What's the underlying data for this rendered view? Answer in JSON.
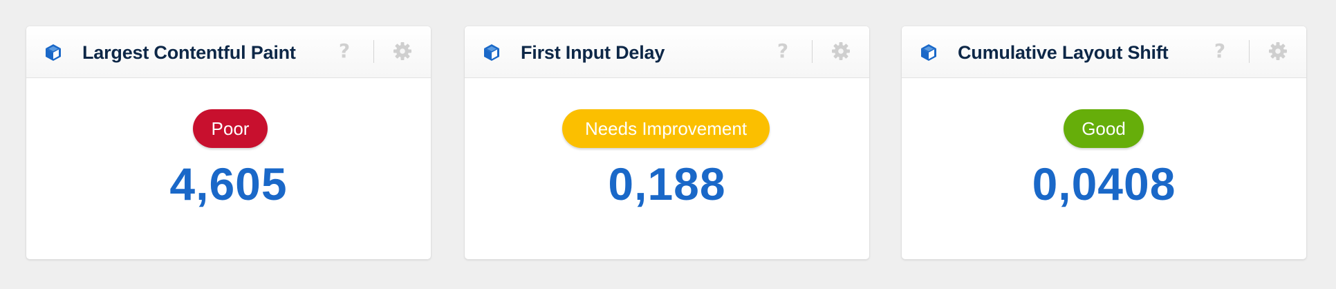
{
  "colors": {
    "poor": "#c8102e",
    "needs_improvement": "#fbbf00",
    "good": "#66ae0a",
    "value": "#1a68c8",
    "title": "#0d2747",
    "icon_blue": "#1a68c8",
    "icon_gray": "#cfcfcf"
  },
  "widgets": [
    {
      "title": "Largest Contentful Paint",
      "icon": "cube-icon",
      "help_label": "?",
      "settings_icon": "gear-icon",
      "status": "Poor",
      "status_color": "#c8102e",
      "value": "4,605"
    },
    {
      "title": "First Input Delay",
      "icon": "cube-icon",
      "help_label": "?",
      "settings_icon": "gear-icon",
      "status": "Needs Improvement",
      "status_color": "#fbbf00",
      "value": "0,188"
    },
    {
      "title": "Cumulative Layout Shift",
      "icon": "cube-icon",
      "help_label": "?",
      "settings_icon": "gear-icon",
      "status": "Good",
      "status_color": "#66ae0a",
      "value": "0,0408"
    }
  ]
}
